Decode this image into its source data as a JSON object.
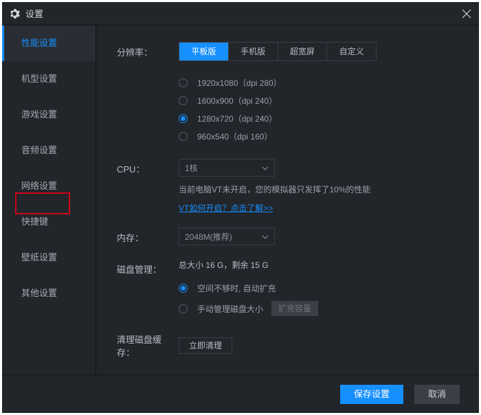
{
  "window": {
    "title": "设置"
  },
  "sidebar": {
    "items": [
      {
        "label": "性能设置"
      },
      {
        "label": "机型设置"
      },
      {
        "label": "游戏设置"
      },
      {
        "label": "音频设置"
      },
      {
        "label": "网络设置"
      },
      {
        "label": "快捷键"
      },
      {
        "label": "壁纸设置"
      },
      {
        "label": "其他设置"
      }
    ],
    "active_index": 0,
    "highlighted_index": 4
  },
  "resolution": {
    "label": "分辨率：",
    "tabs": [
      "平板版",
      "手机版",
      "超宽屏",
      "自定义"
    ],
    "active_tab": 0,
    "options": [
      "1920x1080（dpi 280）",
      "1600x900（dpi 240）",
      "1280x720（dpi 240）",
      "960x540（dpi 160）"
    ],
    "selected_option": 2
  },
  "cpu": {
    "label": "CPU：",
    "value": "1核",
    "hint": "当前电脑VT未开启，您的模拟器只发挥了10%的性能",
    "link": "VT如何开启？点击了解>>"
  },
  "memory": {
    "label": "内存：",
    "value": "2048M(推荐)"
  },
  "disk": {
    "label": "磁盘管理：",
    "status": "总大小 16 G，剩余 15 G",
    "option_auto": "空间不够时, 自动扩充",
    "option_manual": "手动管理磁盘大小",
    "expand_btn": "扩充容量",
    "selected": 0
  },
  "cache": {
    "label": "清理磁盘缓存：",
    "button": "立即清理"
  },
  "footer": {
    "save": "保存设置",
    "cancel": "取消"
  }
}
